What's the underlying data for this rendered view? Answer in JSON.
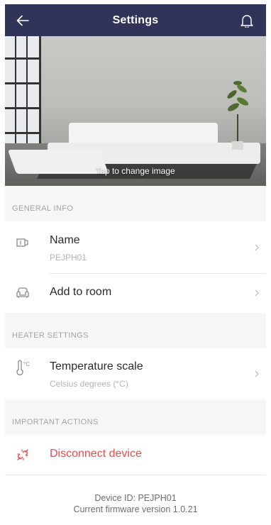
{
  "header": {
    "title": "Settings",
    "back_icon": "arrow-left-icon",
    "bell_icon": "bell-icon",
    "background": "#2f3458"
  },
  "hero": {
    "caption": "Tap to change image"
  },
  "general_info": {
    "header": "GENERAL INFO",
    "name": {
      "label": "Name",
      "value": "PEJPH01",
      "icon": "tag-icon"
    },
    "room": {
      "label": "Add to room",
      "icon": "sofa-icon"
    }
  },
  "heater_settings": {
    "header": "HEATER SETTINGS",
    "temperature": {
      "label": "Temperature scale",
      "value": "Celsius degrees (°C)",
      "icon": "thermometer-icon",
      "icon_text": "°C"
    }
  },
  "important_actions": {
    "header": "IMPORTANT ACTIONS",
    "disconnect": {
      "label": "Disconnect device",
      "icon": "unplug-icon",
      "color": "#e84d4d"
    }
  },
  "footer": {
    "device_id": "Device ID: PEJPH01",
    "firmware": "Current firmware version 1.0.21"
  }
}
